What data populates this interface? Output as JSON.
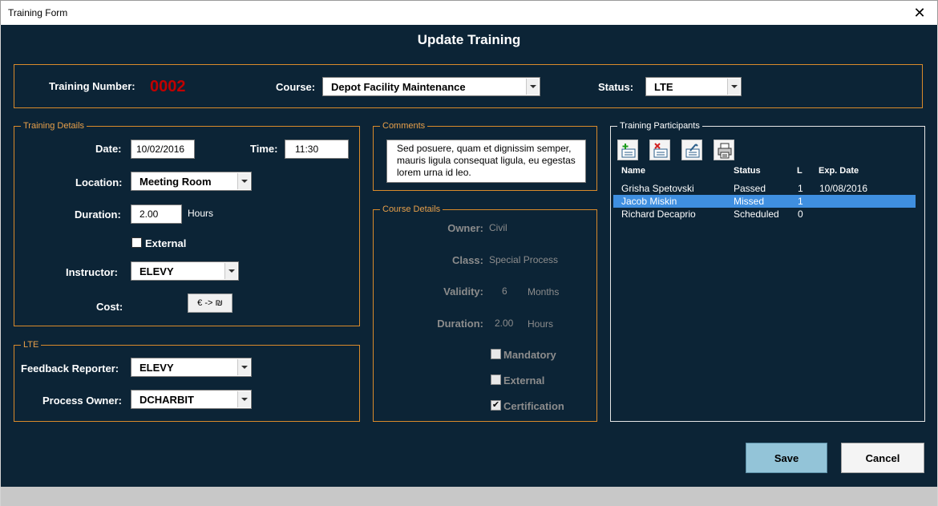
{
  "window": {
    "title": "Training Form",
    "close_glyph": "✕"
  },
  "header": {
    "title": "Update Training"
  },
  "top": {
    "training_number_label": "Training Number:",
    "training_number": "0002",
    "course_label": "Course:",
    "course_value": "Depot Facility Maintenance",
    "status_label": "Status:",
    "status_value": "LTE"
  },
  "training_details": {
    "legend": "Training Details",
    "date_label": "Date:",
    "date_value": "10/02/2016",
    "time_label": "Time:",
    "time_value": "11:30",
    "location_label": "Location:",
    "location_value": "Meeting Room",
    "duration_label": "Duration:",
    "duration_value": "2.00",
    "duration_unit": "Hours",
    "external_label": "External",
    "external_checked": false,
    "instructor_label": "Instructor:",
    "instructor_value": "ELEVY",
    "cost_label": "Cost:",
    "cost_button": "€ -> ₪"
  },
  "lte": {
    "legend": "LTE",
    "feedback_reporter_label": "Feedback Reporter:",
    "feedback_reporter_value": "ELEVY",
    "process_owner_label": "Process Owner:",
    "process_owner_value": "DCHARBIT"
  },
  "comments": {
    "legend": "Comments",
    "text": "Sed posuere, quam et dignissim semper, mauris ligula consequat ligula, eu egestas lorem urna id leo."
  },
  "course_details": {
    "legend": "Course Details",
    "owner_label": "Owner:",
    "owner_value": "Civil",
    "class_label": "Class:",
    "class_value": "Special Process",
    "validity_label": "Validity:",
    "validity_value": "6",
    "validity_unit": "Months",
    "duration_label": "Duration:",
    "duration_value": "2.00",
    "duration_unit": "Hours",
    "mandatory_label": "Mandatory",
    "external_label": "External",
    "certification_label": "Certification",
    "checked_mark": "✔"
  },
  "participants": {
    "legend": "Training Participants",
    "toolbar_icons": [
      "add-participant-icon",
      "remove-participant-icon",
      "edit-participant-icon",
      "print-participants-icon"
    ],
    "columns": [
      "Name",
      "Status",
      "L",
      "Exp. Date"
    ],
    "rows": [
      {
        "name": "Grisha Spetovski",
        "status": "Passed",
        "l": "1",
        "exp": "10/08/2016",
        "selected": false
      },
      {
        "name": "Jacob Miskin",
        "status": "Missed",
        "l": "1",
        "exp": "",
        "selected": true
      },
      {
        "name": "Richard Decaprio",
        "status": "Scheduled",
        "l": "0",
        "exp": "",
        "selected": false
      }
    ]
  },
  "buttons": {
    "save": "Save",
    "cancel": "Cancel"
  },
  "colors": {
    "form_bg": "#0c2436",
    "frame_border": "#d98a2b",
    "training_number": "#c00000",
    "selection": "#3f8fe0",
    "save_button": "#93c4d8"
  }
}
